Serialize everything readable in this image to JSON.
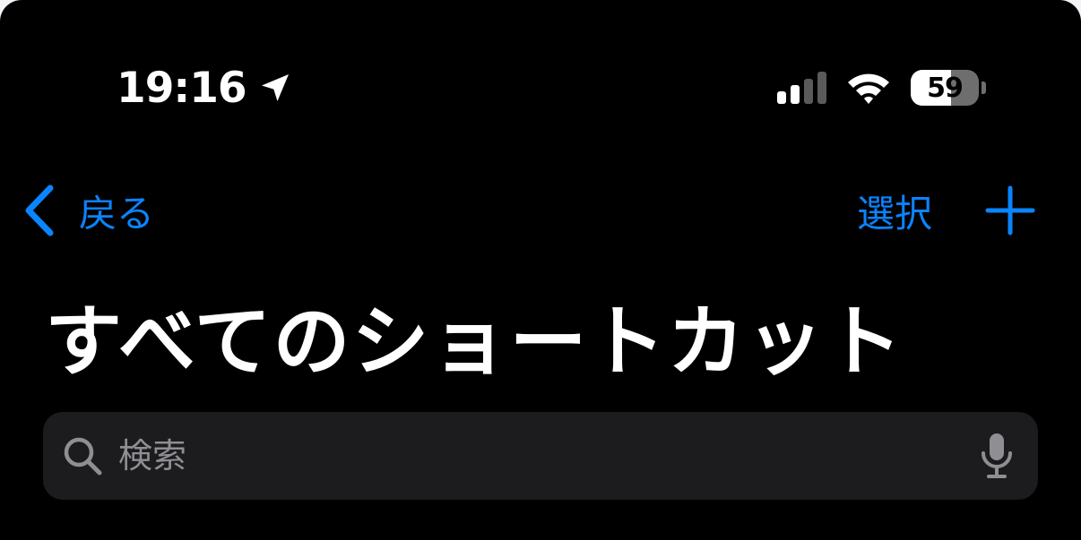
{
  "status_bar": {
    "time": "19:16",
    "battery_level": "59",
    "battery_fraction": 0.59,
    "signal_bars_active": 2,
    "signal_bars_total": 4,
    "icons": [
      "location-arrow-icon",
      "cellular-signal-icon",
      "wifi-icon",
      "battery-icon"
    ]
  },
  "nav": {
    "back_label": "戻る",
    "select_label": "選択",
    "add_icon": "plus-icon",
    "back_icon": "chevron-left-icon"
  },
  "title": "すべてのショートカット",
  "search": {
    "placeholder": "検索",
    "value": "",
    "icon": "search-icon",
    "mic_icon": "microphone-icon"
  },
  "colors": {
    "background": "#000000",
    "accent": "#0a84ff",
    "search_field": "#1c1c1e",
    "placeholder": "#8e8e93"
  }
}
